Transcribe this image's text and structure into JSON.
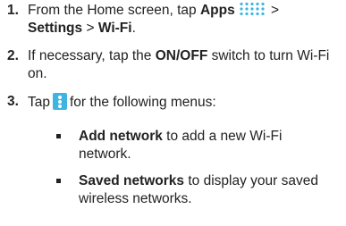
{
  "steps": [
    {
      "number": "1.",
      "part1": "From the Home screen, tap ",
      "apps_bold": "Apps",
      "part2": " >",
      "settings_bold": "Settings",
      "part3": " > ",
      "wifi_bold": "Wi-Fi",
      "part4": "."
    },
    {
      "number": "2.",
      "part1": "If necessary, tap the ",
      "switch_bold": "ON/OFF",
      "part2": " switch to turn Wi-Fi on."
    },
    {
      "number": "3.",
      "part1": "Tap",
      "part2": "for the following menus:"
    }
  ],
  "bullets": [
    {
      "bold": "Add network",
      "text": " to add a new Wi-Fi network."
    },
    {
      "bold": "Saved networks",
      "text": " to display your saved wireless networks."
    }
  ],
  "icons": {
    "apps": "apps-grid-icon",
    "menu": "more-options-icon",
    "menu_color": "#3db5e0",
    "apps_color": "#3db5e0"
  }
}
